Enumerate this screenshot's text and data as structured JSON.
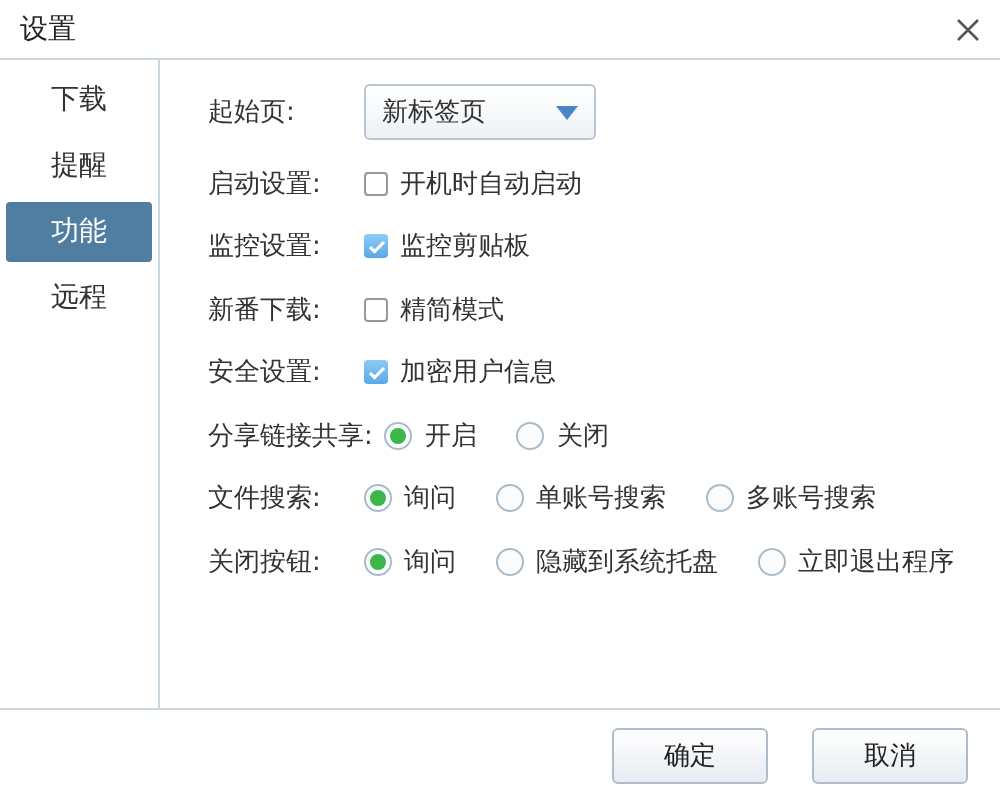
{
  "window": {
    "title": "设置"
  },
  "sidebar": {
    "items": [
      {
        "label": "下载",
        "selected": false
      },
      {
        "label": "提醒",
        "selected": false
      },
      {
        "label": "功能",
        "selected": true
      },
      {
        "label": "远程",
        "selected": false
      }
    ]
  },
  "settings": [
    {
      "kind": "select",
      "label": "起始页:",
      "value": "新标签页"
    },
    {
      "kind": "checkbox",
      "label": "启动设置:",
      "option": "开机时自动启动",
      "checked": false
    },
    {
      "kind": "checkbox",
      "label": "监控设置:",
      "option": "监控剪贴板",
      "checked": true
    },
    {
      "kind": "checkbox",
      "label": "新番下载:",
      "option": "精简模式",
      "checked": false
    },
    {
      "kind": "checkbox",
      "label": "安全设置:",
      "option": "加密用户信息",
      "checked": true
    },
    {
      "kind": "radio",
      "label": "分享链接共享:",
      "options": [
        {
          "label": "开启",
          "selected": true
        },
        {
          "label": "关闭",
          "selected": false
        }
      ]
    },
    {
      "kind": "radio",
      "label": "文件搜索:",
      "options": [
        {
          "label": "询问",
          "selected": true
        },
        {
          "label": "单账号搜索",
          "selected": false
        },
        {
          "label": "多账号搜索",
          "selected": false
        }
      ]
    },
    {
      "kind": "radio",
      "label": "关闭按钮:",
      "options": [
        {
          "label": "询问",
          "selected": true
        },
        {
          "label": "隐藏到系统托盘",
          "selected": false
        },
        {
          "label": "立即退出程序",
          "selected": false
        }
      ]
    }
  ],
  "buttons": [
    "确定",
    "取消"
  ]
}
